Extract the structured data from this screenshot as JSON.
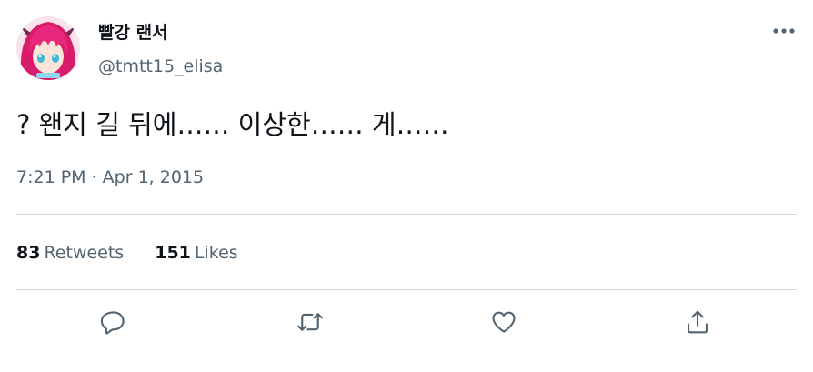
{
  "user": {
    "display_name": "빨강 랜서",
    "handle": "@tmtt15_elisa",
    "avatar_icon": "anime-avatar"
  },
  "tweet": {
    "text": "? 왠지 길 뒤에…… 이상한…… 게……",
    "timestamp": "7:21 PM · Apr 1, 2015"
  },
  "stats": {
    "retweets_count": "83",
    "retweets_label": "Retweets",
    "likes_count": "151",
    "likes_label": "Likes"
  },
  "actions": [
    "reply-icon",
    "retweet-icon",
    "like-icon",
    "share-icon"
  ],
  "colors": {
    "text": "#0f1419",
    "secondary": "#536471",
    "divider": "#cfd9de",
    "avatar_hair": "#e8287a"
  }
}
